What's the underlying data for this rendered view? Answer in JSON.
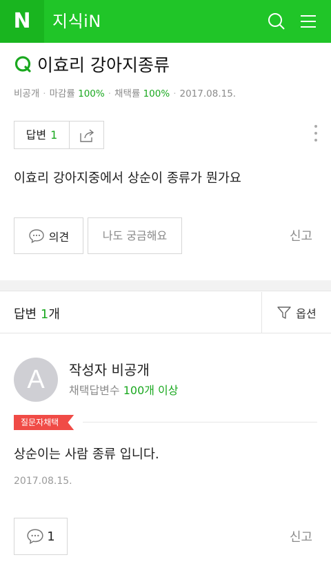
{
  "header": {
    "logo": "N",
    "brand": "지식iN",
    "bg_color": "#20c528"
  },
  "question": {
    "title": "이효리 강아지종류",
    "meta": {
      "privacy": "비공개",
      "close_rate_label": "마감률",
      "close_rate": "100%",
      "adopt_rate_label": "채택률",
      "adopt_rate": "100%",
      "date": "2017.08.15."
    },
    "answer_label": "답변",
    "answer_count": "1",
    "body": "이효리 강아지중에서 상순이 종류가 뭔가요",
    "opinion_label": "의견",
    "curious_label": "나도 궁금해요",
    "report_label": "신고"
  },
  "answers": {
    "header_label": "답변",
    "count": "1",
    "unit": "개",
    "options_label": "옵션",
    "items": [
      {
        "avatar_letter": "A",
        "author": "작성자 비공개",
        "stat_label": "채택답변수",
        "stat_value": "100개 이상",
        "badge": "질문자채택",
        "text": "상순이는 사람 종류 입니다.",
        "date": "2017.08.15.",
        "comment_count": "1",
        "report_label": "신고"
      }
    ]
  },
  "icons": [
    "search-icon",
    "menu-icon",
    "q-icon",
    "share-icon",
    "more-icon",
    "speech-bubble-icon",
    "filter-icon"
  ],
  "colors": {
    "accent": "#1aa81f",
    "badge": "#f04b46"
  }
}
